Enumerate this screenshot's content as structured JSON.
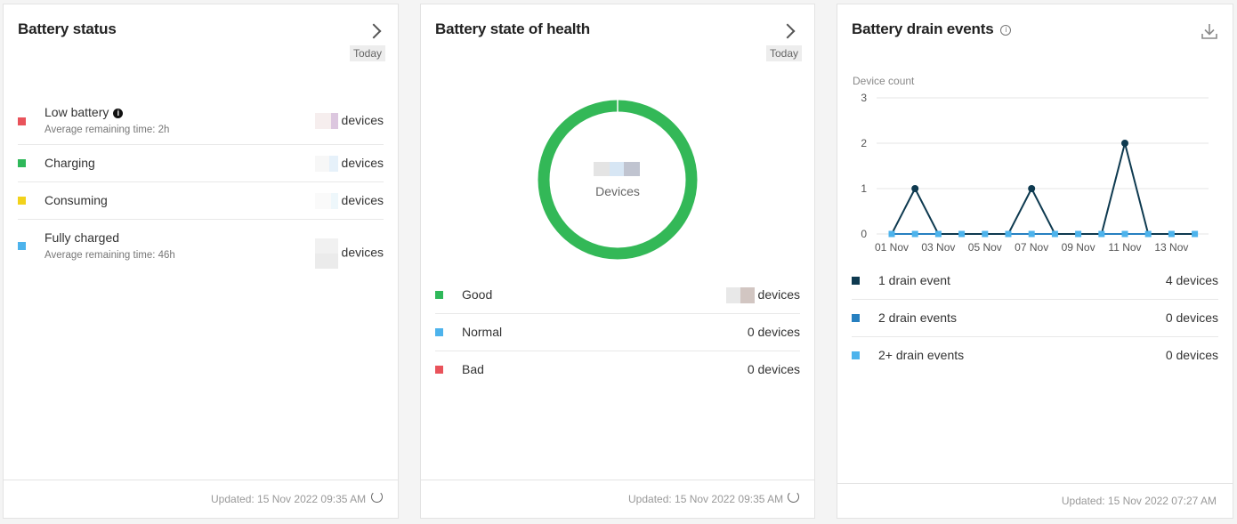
{
  "battery_status": {
    "title": "Battery status",
    "period": "Today",
    "items": [
      {
        "label": "Low battery",
        "sub": "Average remaining time: 2h",
        "value_unit": "devices",
        "color": "#e9535b"
      },
      {
        "label": "Charging",
        "sub": "",
        "value_unit": "devices",
        "color": "#2fb85a"
      },
      {
        "label": "Consuming",
        "sub": "",
        "value_unit": "devices",
        "color": "#f2d21b"
      },
      {
        "label": "Fully charged",
        "sub": "Average remaining time: 46h",
        "value_unit": "devices",
        "color": "#4db3ec"
      }
    ],
    "updated": "Updated: 15 Nov 2022 09:35 AM"
  },
  "state_of_health": {
    "title": "Battery state of health",
    "period": "Today",
    "donut_label": "Devices",
    "donut_color": "#33b857",
    "items": [
      {
        "label": "Good",
        "value": "devices",
        "color": "#2fb85a"
      },
      {
        "label": "Normal",
        "value": "0 devices",
        "color": "#4db3ec"
      },
      {
        "label": "Bad",
        "value": "0 devices",
        "color": "#e9535b"
      }
    ],
    "updated": "Updated: 15 Nov 2022 09:35 AM"
  },
  "drain_events": {
    "title": "Battery drain events",
    "updated": "Updated: 15 Nov 2022 07:27 AM",
    "legend": [
      {
        "label": "1 drain event",
        "value": "4 devices",
        "color": "#0e3a50"
      },
      {
        "label": "2 drain events",
        "value": "0 devices",
        "color": "#2780c0"
      },
      {
        "label": "2+ drain events",
        "value": "0 devices",
        "color": "#4db3ec"
      }
    ]
  },
  "chart_data": {
    "type": "line",
    "ylabel": "Device count",
    "ylim": [
      0,
      3
    ],
    "yticks": [
      "0",
      "1",
      "2",
      "3"
    ],
    "x": [
      "01 Nov",
      "02 Nov",
      "03 Nov",
      "04 Nov",
      "05 Nov",
      "06 Nov",
      "07 Nov",
      "08 Nov",
      "09 Nov",
      "10 Nov",
      "11 Nov",
      "12 Nov",
      "13 Nov",
      "14 Nov"
    ],
    "xtick_labels": [
      "01 Nov",
      "03 Nov",
      "05 Nov",
      "07 Nov",
      "09 Nov",
      "11 Nov",
      "13 Nov"
    ],
    "series": [
      {
        "name": "1 drain event",
        "color": "#0e3a50",
        "values": [
          0,
          1,
          0,
          0,
          0,
          0,
          1,
          0,
          0,
          0,
          2,
          0,
          0,
          0
        ]
      },
      {
        "name": "2 drain events",
        "color": "#2780c0",
        "values": [
          0,
          0,
          0,
          0,
          0,
          0,
          0,
          0,
          0,
          0,
          0,
          0,
          0,
          0
        ]
      },
      {
        "name": "2+ drain events",
        "color": "#4db3ec",
        "values": [
          0,
          0,
          0,
          0,
          0,
          0,
          0,
          0,
          0,
          0,
          0,
          0,
          0,
          0
        ]
      }
    ],
    "grid": true
  }
}
